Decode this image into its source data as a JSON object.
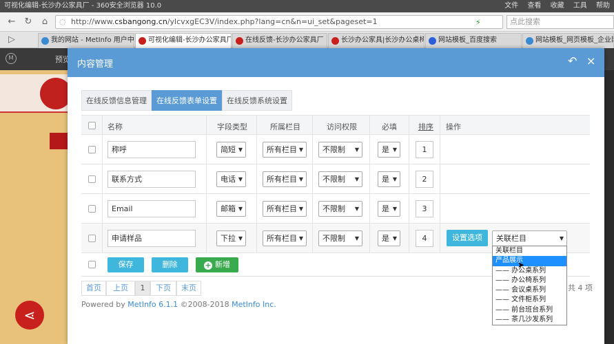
{
  "browser": {
    "window_title": "可视化编辑-长沙办公家具厂 - 360安全浏览器 10.0",
    "menu": [
      "文件",
      "查看",
      "收藏",
      "工具",
      "帮助"
    ],
    "url_scheme": "http://www.",
    "url_host": "csbangong.cn",
    "url_path": "/ylcvxgEC3V/index.php?lang=cn&n=ui_set&pageset=1",
    "search_placeholder": "点此搜索",
    "tabs": [
      {
        "label": "我的网站 - MetInfo 用户中心",
        "color": "#3a8ad1"
      },
      {
        "label": "可视化编辑-长沙办公家具厂",
        "color": "#c8201c"
      },
      {
        "label": "在线反馈-长沙办公家具厂",
        "color": "#c8201c"
      },
      {
        "label": "长沙办公家具|长沙办公桌椅",
        "color": "#c8201c"
      },
      {
        "label": "网站模板_百度搜索",
        "color": "#2b5fd9"
      },
      {
        "label": "网站模板_网页模板_企业网",
        "color": "#3a8ad1"
      }
    ]
  },
  "page": {
    "preview_label": "预览"
  },
  "modal": {
    "title": "内容管理",
    "tabs": [
      "在线反馈信息管理",
      "在线反馈表单设置",
      "在线反馈系统设置"
    ],
    "columns": [
      "名称",
      "字段类型",
      "所属栏目",
      "访问权限",
      "必填",
      "排序",
      "操作"
    ],
    "rows": [
      {
        "name": "称呼",
        "type": "简短",
        "column": "所有栏目",
        "access": "不限制",
        "required": "是",
        "order": "1"
      },
      {
        "name": "联系方式",
        "type": "电话",
        "column": "所有栏目",
        "access": "不限制",
        "required": "是",
        "order": "2"
      },
      {
        "name": "Email",
        "type": "邮箱",
        "column": "所有栏目",
        "access": "不限制",
        "required": "是",
        "order": "3"
      },
      {
        "name": "申请样品",
        "type": "下拉",
        "column": "所有栏目",
        "access": "不限制",
        "required": "是",
        "order": "4",
        "option_button": "设置选项",
        "link_select": "关联栏目"
      }
    ],
    "actions": {
      "save": "保存",
      "delete": "删除",
      "add": "新增"
    },
    "dropdown_options": [
      "关联栏目",
      "产品展示",
      "—— 办公桌系列",
      "—— 办公椅系列",
      "—— 会议桌系列",
      "—— 文件柜系列",
      "—— 前台班台系列",
      "—— 茶几沙发系列"
    ],
    "dropdown_highlight": 1,
    "pager": [
      "首页",
      "上页",
      "1",
      "下页",
      "末页"
    ],
    "total": "共 4 项",
    "footer_prefix": "Powered by ",
    "footer_link": "MetInfo 6.1.1",
    "footer_mid": " ©2008-2018 ",
    "footer_link2": "MetInfo Inc."
  }
}
